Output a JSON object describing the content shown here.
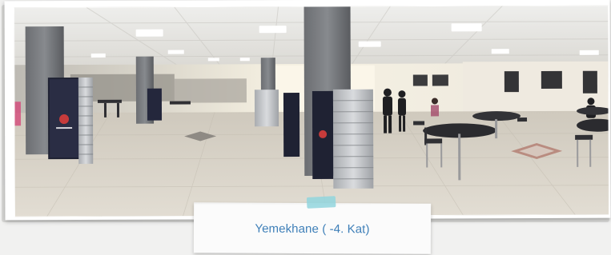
{
  "caption": {
    "text": "Yemekhane  ( -4. Kat)"
  },
  "image": {
    "scene": "cafeteria-interior-panorama"
  },
  "colors": {
    "caption_text": "#3e7fb8",
    "tape": "#92d5dd",
    "paper": "#fbfbfb",
    "background": "#f1f1f0"
  }
}
